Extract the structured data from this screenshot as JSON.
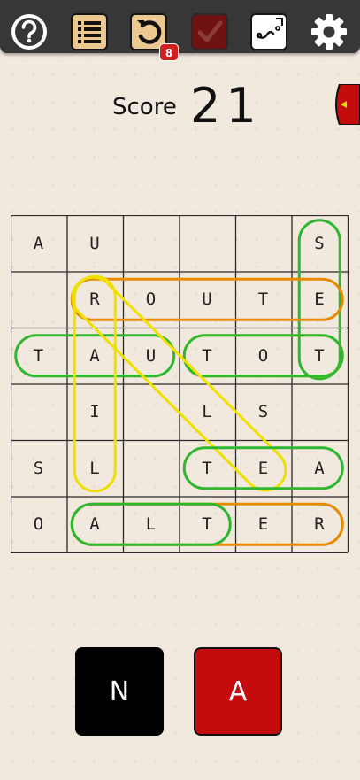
{
  "toolbar": {
    "help": "help",
    "list": "word-list",
    "undo_count": "8",
    "check": "check",
    "hint": "hint",
    "settings": "settings"
  },
  "score": {
    "label": "Score",
    "value": "21"
  },
  "grid": {
    "rows": [
      [
        "A",
        "U",
        "",
        "",
        "",
        "S"
      ],
      [
        "",
        "R",
        "O",
        "U",
        "T",
        "E"
      ],
      [
        "T",
        "A",
        "U",
        "T",
        "O",
        "T"
      ],
      [
        "",
        "I",
        "",
        "L",
        "S",
        ""
      ],
      [
        "S",
        "L",
        "",
        "T",
        "E",
        "A"
      ],
      [
        "O",
        "A",
        "L",
        "T",
        "E",
        "R"
      ]
    ]
  },
  "highlights": [
    {
      "color": "#2fb72f",
      "word": "SET",
      "from": [
        0,
        5
      ],
      "to": [
        2,
        5
      ]
    },
    {
      "color": "#e68a00",
      "word": "ROUTE",
      "from": [
        1,
        1
      ],
      "to": [
        1,
        5
      ]
    },
    {
      "color": "#2fb72f",
      "word": "TAU",
      "from": [
        2,
        0
      ],
      "to": [
        2,
        2
      ]
    },
    {
      "color": "#f0e000",
      "word": "TOT",
      "from": [
        2,
        3
      ],
      "to": [
        2,
        5
      ]
    },
    {
      "color": "#2fb72f",
      "word": "TOT",
      "from": [
        2,
        3
      ],
      "to": [
        2,
        5
      ]
    },
    {
      "color": "#f0e000",
      "word": "RAIL",
      "from": [
        1,
        1
      ],
      "to": [
        4,
        1
      ]
    },
    {
      "color": "#f0e000",
      "word": "RULE",
      "from": [
        1,
        1
      ],
      "to": [
        4,
        4
      ]
    },
    {
      "color": "#2fb72f",
      "word": "TEA",
      "from": [
        4,
        3
      ],
      "to": [
        4,
        5
      ]
    },
    {
      "color": "#e68a00",
      "word": "ALTER",
      "from": [
        5,
        1
      ],
      "to": [
        5,
        5
      ]
    },
    {
      "color": "#2fb72f",
      "word": "ALT",
      "from": [
        5,
        1
      ],
      "to": [
        5,
        3
      ]
    }
  ],
  "tiles": {
    "left": "N",
    "right": "A"
  },
  "colors": {
    "topbar": "#373737",
    "accent": "#c40c0c",
    "paper": "#f1e9de"
  }
}
